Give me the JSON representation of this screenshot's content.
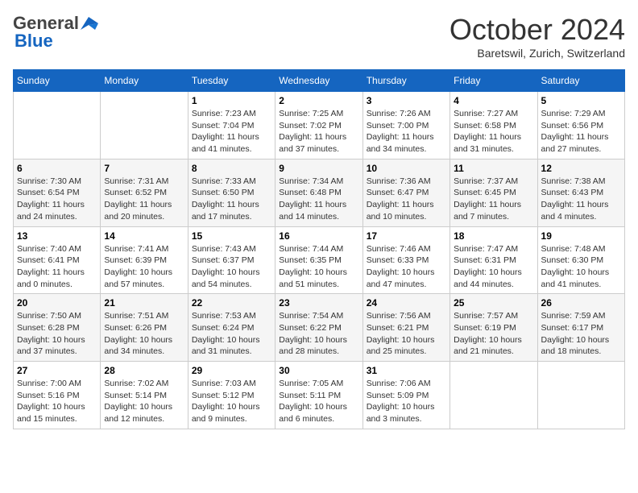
{
  "header": {
    "logo_general": "General",
    "logo_blue": "Blue",
    "month": "October 2024",
    "location": "Baretswil, Zurich, Switzerland"
  },
  "days_of_week": [
    "Sunday",
    "Monday",
    "Tuesday",
    "Wednesday",
    "Thursday",
    "Friday",
    "Saturday"
  ],
  "weeks": [
    [
      {
        "day": "",
        "info": ""
      },
      {
        "day": "",
        "info": ""
      },
      {
        "day": "1",
        "info": "Sunrise: 7:23 AM\nSunset: 7:04 PM\nDaylight: 11 hours and 41 minutes."
      },
      {
        "day": "2",
        "info": "Sunrise: 7:25 AM\nSunset: 7:02 PM\nDaylight: 11 hours and 37 minutes."
      },
      {
        "day": "3",
        "info": "Sunrise: 7:26 AM\nSunset: 7:00 PM\nDaylight: 11 hours and 34 minutes."
      },
      {
        "day": "4",
        "info": "Sunrise: 7:27 AM\nSunset: 6:58 PM\nDaylight: 11 hours and 31 minutes."
      },
      {
        "day": "5",
        "info": "Sunrise: 7:29 AM\nSunset: 6:56 PM\nDaylight: 11 hours and 27 minutes."
      }
    ],
    [
      {
        "day": "6",
        "info": "Sunrise: 7:30 AM\nSunset: 6:54 PM\nDaylight: 11 hours and 24 minutes."
      },
      {
        "day": "7",
        "info": "Sunrise: 7:31 AM\nSunset: 6:52 PM\nDaylight: 11 hours and 20 minutes."
      },
      {
        "day": "8",
        "info": "Sunrise: 7:33 AM\nSunset: 6:50 PM\nDaylight: 11 hours and 17 minutes."
      },
      {
        "day": "9",
        "info": "Sunrise: 7:34 AM\nSunset: 6:48 PM\nDaylight: 11 hours and 14 minutes."
      },
      {
        "day": "10",
        "info": "Sunrise: 7:36 AM\nSunset: 6:47 PM\nDaylight: 11 hours and 10 minutes."
      },
      {
        "day": "11",
        "info": "Sunrise: 7:37 AM\nSunset: 6:45 PM\nDaylight: 11 hours and 7 minutes."
      },
      {
        "day": "12",
        "info": "Sunrise: 7:38 AM\nSunset: 6:43 PM\nDaylight: 11 hours and 4 minutes."
      }
    ],
    [
      {
        "day": "13",
        "info": "Sunrise: 7:40 AM\nSunset: 6:41 PM\nDaylight: 11 hours and 0 minutes."
      },
      {
        "day": "14",
        "info": "Sunrise: 7:41 AM\nSunset: 6:39 PM\nDaylight: 10 hours and 57 minutes."
      },
      {
        "day": "15",
        "info": "Sunrise: 7:43 AM\nSunset: 6:37 PM\nDaylight: 10 hours and 54 minutes."
      },
      {
        "day": "16",
        "info": "Sunrise: 7:44 AM\nSunset: 6:35 PM\nDaylight: 10 hours and 51 minutes."
      },
      {
        "day": "17",
        "info": "Sunrise: 7:46 AM\nSunset: 6:33 PM\nDaylight: 10 hours and 47 minutes."
      },
      {
        "day": "18",
        "info": "Sunrise: 7:47 AM\nSunset: 6:31 PM\nDaylight: 10 hours and 44 minutes."
      },
      {
        "day": "19",
        "info": "Sunrise: 7:48 AM\nSunset: 6:30 PM\nDaylight: 10 hours and 41 minutes."
      }
    ],
    [
      {
        "day": "20",
        "info": "Sunrise: 7:50 AM\nSunset: 6:28 PM\nDaylight: 10 hours and 37 minutes."
      },
      {
        "day": "21",
        "info": "Sunrise: 7:51 AM\nSunset: 6:26 PM\nDaylight: 10 hours and 34 minutes."
      },
      {
        "day": "22",
        "info": "Sunrise: 7:53 AM\nSunset: 6:24 PM\nDaylight: 10 hours and 31 minutes."
      },
      {
        "day": "23",
        "info": "Sunrise: 7:54 AM\nSunset: 6:22 PM\nDaylight: 10 hours and 28 minutes."
      },
      {
        "day": "24",
        "info": "Sunrise: 7:56 AM\nSunset: 6:21 PM\nDaylight: 10 hours and 25 minutes."
      },
      {
        "day": "25",
        "info": "Sunrise: 7:57 AM\nSunset: 6:19 PM\nDaylight: 10 hours and 21 minutes."
      },
      {
        "day": "26",
        "info": "Sunrise: 7:59 AM\nSunset: 6:17 PM\nDaylight: 10 hours and 18 minutes."
      }
    ],
    [
      {
        "day": "27",
        "info": "Sunrise: 7:00 AM\nSunset: 5:16 PM\nDaylight: 10 hours and 15 minutes."
      },
      {
        "day": "28",
        "info": "Sunrise: 7:02 AM\nSunset: 5:14 PM\nDaylight: 10 hours and 12 minutes."
      },
      {
        "day": "29",
        "info": "Sunrise: 7:03 AM\nSunset: 5:12 PM\nDaylight: 10 hours and 9 minutes."
      },
      {
        "day": "30",
        "info": "Sunrise: 7:05 AM\nSunset: 5:11 PM\nDaylight: 10 hours and 6 minutes."
      },
      {
        "day": "31",
        "info": "Sunrise: 7:06 AM\nSunset: 5:09 PM\nDaylight: 10 hours and 3 minutes."
      },
      {
        "day": "",
        "info": ""
      },
      {
        "day": "",
        "info": ""
      }
    ]
  ]
}
